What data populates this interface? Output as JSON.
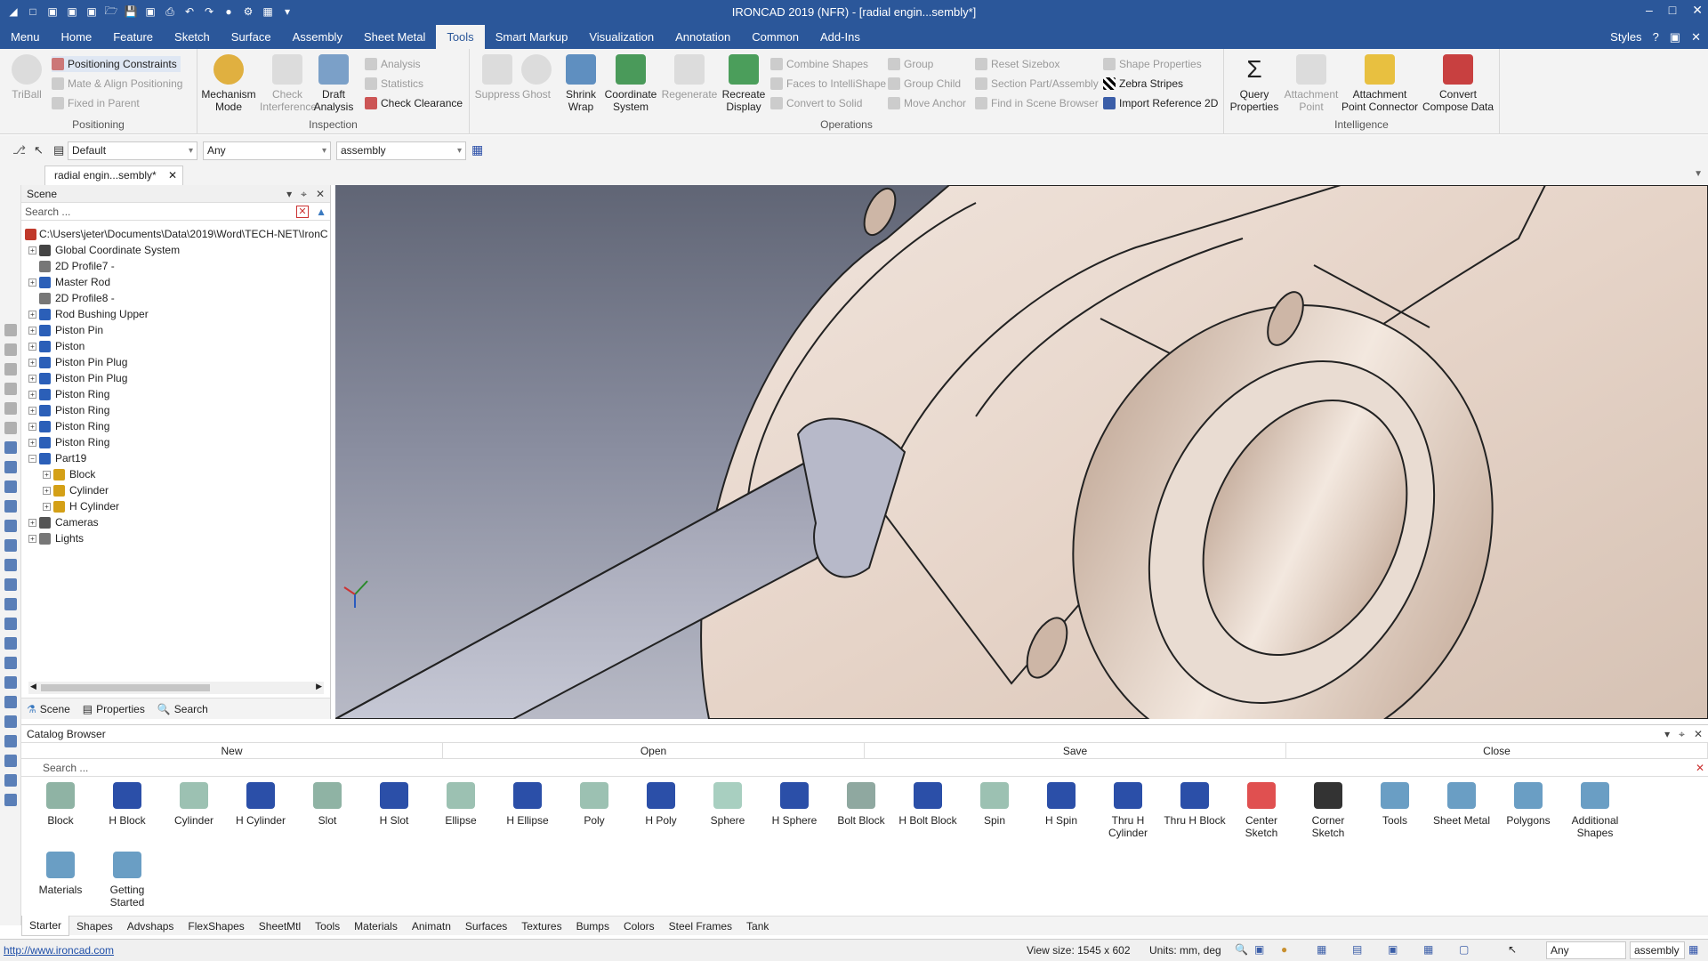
{
  "window": {
    "title": "IRONCAD 2019 (NFR) - [radial engin...sembly*]",
    "min": "–",
    "max": "□",
    "close": "✕"
  },
  "menubar": {
    "tabs": [
      "Menu",
      "Home",
      "Feature",
      "Sketch",
      "Surface",
      "Assembly",
      "Sheet Metal",
      "Tools",
      "Smart Markup",
      "Visualization",
      "Annotation",
      "Common",
      "Add-Ins"
    ],
    "active": "Tools",
    "styles": "Styles",
    "help": "?"
  },
  "ribbon": {
    "positioning": {
      "title": "Positioning",
      "triball": "TriBall",
      "constraints": "Positioning Constraints",
      "mate": "Mate & Align Positioning",
      "fixed": "Fixed in Parent"
    },
    "inspection": {
      "title": "Inspection",
      "mechanism": "Mechanism Mode",
      "check_interference": "Check Interference",
      "draft_analysis": "Draft Analysis",
      "analysis": "Analysis",
      "statistics": "Statistics",
      "check_clearance": "Check Clearance"
    },
    "operations": {
      "title": "Operations",
      "suppress": "Suppress",
      "ghost": "Ghost",
      "shrink_wrap": "Shrink Wrap",
      "coordinate_system": "Coordinate System",
      "regenerate": "Regenerate",
      "recreate_display": "Recreate Display",
      "combine_shapes": "Combine Shapes",
      "faces_intellishape": "Faces to IntelliShape",
      "convert_solid": "Convert to Solid",
      "group": "Group",
      "group_child": "Group Child",
      "move_anchor": "Move Anchor",
      "reset_sizebox": "Reset Sizebox",
      "section_part": "Section Part/Assembly",
      "find_scene": "Find in Scene Browser",
      "shape_properties": "Shape Properties",
      "zebra_stripes": "Zebra Stripes",
      "import_ref": "Import Reference 2D"
    },
    "intelligence": {
      "title": "Intelligence",
      "query_properties": "Query Properties",
      "attachment_point": "Attachment Point",
      "attachment_connector": "Attachment Point Connector",
      "convert_compose": "Convert Compose Data"
    }
  },
  "toolrow": {
    "style_combo": "Default",
    "filter_combo": "Any",
    "level_combo": "assembly"
  },
  "doc_tab": {
    "label": "radial engin...sembly*",
    "close": "✕"
  },
  "scene": {
    "title": "Scene",
    "search_placeholder": "Search ...",
    "tree": [
      {
        "label": "C:\\Users\\jeter\\Documents\\Data\\2019\\Word\\TECH-NET\\IronC",
        "level": 0,
        "icon": "assembly-root-icon",
        "color": "#c0392b",
        "exp": ""
      },
      {
        "label": "Global Coordinate System",
        "level": 1,
        "icon": "coordinate-system-icon",
        "color": "#444",
        "exp": "+"
      },
      {
        "label": "2D Profile7 -",
        "level": 1,
        "icon": "profile-2d-icon",
        "color": "#777",
        "exp": ""
      },
      {
        "label": "Master Rod",
        "level": 1,
        "icon": "part-icon",
        "color": "#2b5fb8",
        "exp": "+"
      },
      {
        "label": "2D Profile8 -",
        "level": 1,
        "icon": "profile-2d-icon",
        "color": "#777",
        "exp": ""
      },
      {
        "label": "Rod Bushing Upper",
        "level": 1,
        "icon": "part-icon",
        "color": "#2b5fb8",
        "exp": "+"
      },
      {
        "label": "Piston Pin",
        "level": 1,
        "icon": "part-icon",
        "color": "#2b5fb8",
        "exp": "+"
      },
      {
        "label": "Piston",
        "level": 1,
        "icon": "part-icon",
        "color": "#2b5fb8",
        "exp": "+"
      },
      {
        "label": "Piston Pin Plug",
        "level": 1,
        "icon": "part-icon",
        "color": "#2b5fb8",
        "exp": "+"
      },
      {
        "label": "Piston Pin Plug",
        "level": 1,
        "icon": "part-icon",
        "color": "#2b5fb8",
        "exp": "+"
      },
      {
        "label": "Piston Ring",
        "level": 1,
        "icon": "part-icon",
        "color": "#2b5fb8",
        "exp": "+"
      },
      {
        "label": "Piston Ring",
        "level": 1,
        "icon": "part-icon",
        "color": "#2b5fb8",
        "exp": "+"
      },
      {
        "label": "Piston Ring",
        "level": 1,
        "icon": "part-icon",
        "color": "#2b5fb8",
        "exp": "+"
      },
      {
        "label": "Piston Ring",
        "level": 1,
        "icon": "part-icon",
        "color": "#2b5fb8",
        "exp": "+"
      },
      {
        "label": "Part19",
        "level": 1,
        "icon": "part-icon",
        "color": "#2b5fb8",
        "exp": "−"
      },
      {
        "label": "Block",
        "level": 2,
        "icon": "feature-icon",
        "color": "#d4a017",
        "exp": "+"
      },
      {
        "label": "Cylinder",
        "level": 2,
        "icon": "feature-icon",
        "color": "#d4a017",
        "exp": "+"
      },
      {
        "label": "H Cylinder",
        "level": 2,
        "icon": "feature-icon",
        "color": "#d4a017",
        "exp": "+"
      },
      {
        "label": "Cameras",
        "level": 1,
        "icon": "camera-icon",
        "color": "#555",
        "exp": "+"
      },
      {
        "label": "Lights",
        "level": 1,
        "icon": "light-icon",
        "color": "#777",
        "exp": "+"
      }
    ],
    "tabs": {
      "scene": "Scene",
      "properties": "Properties",
      "search": "Search"
    }
  },
  "catalog": {
    "title": "Catalog Browser",
    "new": "New",
    "open": "Open",
    "save": "Save",
    "close": "Close",
    "search_placeholder": "Search ...",
    "items": [
      {
        "label": "Block",
        "icon": "block-icon",
        "color": "#8fb3a4"
      },
      {
        "label": "H Block",
        "icon": "h-block-icon",
        "color": "#2b4fa8"
      },
      {
        "label": "Cylinder",
        "icon": "cylinder-icon",
        "color": "#9cc1b2"
      },
      {
        "label": "H Cylinder",
        "icon": "h-cylinder-icon",
        "color": "#2b4fa8"
      },
      {
        "label": "Slot",
        "icon": "slot-icon",
        "color": "#8fb3a4"
      },
      {
        "label": "H Slot",
        "icon": "h-slot-icon",
        "color": "#2b4fa8"
      },
      {
        "label": "Ellipse",
        "icon": "ellipse-icon",
        "color": "#9cc1b2"
      },
      {
        "label": "H Ellipse",
        "icon": "h-ellipse-icon",
        "color": "#2b4fa8"
      },
      {
        "label": "Poly",
        "icon": "poly-icon",
        "color": "#9cc1b2"
      },
      {
        "label": "H Poly",
        "icon": "h-poly-icon",
        "color": "#2b4fa8"
      },
      {
        "label": "Sphere",
        "icon": "sphere-icon",
        "color": "#a8cfc0"
      },
      {
        "label": "H Sphere",
        "icon": "h-sphere-icon",
        "color": "#2b4fa8"
      },
      {
        "label": "Bolt Block",
        "icon": "bolt-block-icon",
        "color": "#8fa8a0"
      },
      {
        "label": "H Bolt Block",
        "icon": "h-bolt-block-icon",
        "color": "#2b4fa8"
      },
      {
        "label": "Spin",
        "icon": "spin-icon",
        "color": "#9cc1b2"
      },
      {
        "label": "H Spin",
        "icon": "h-spin-icon",
        "color": "#2b4fa8"
      },
      {
        "label": "Thru H Cylinder",
        "icon": "thru-h-cylinder-icon",
        "color": "#2b4fa8"
      },
      {
        "label": "Thru H Block",
        "icon": "thru-h-block-icon",
        "color": "#2b4fa8"
      },
      {
        "label": "Center Sketch",
        "icon": "center-sketch-icon",
        "color": "#e05050"
      },
      {
        "label": "Corner Sketch",
        "icon": "corner-sketch-icon",
        "color": "#333"
      },
      {
        "label": "Tools",
        "icon": "tools-folder-icon",
        "color": "#6a9ec4"
      },
      {
        "label": "Sheet Metal",
        "icon": "sheet-metal-folder-icon",
        "color": "#6a9ec4"
      },
      {
        "label": "Polygons",
        "icon": "polygons-folder-icon",
        "color": "#6a9ec4"
      },
      {
        "label": "Additional Shapes",
        "icon": "additional-shapes-folder-icon",
        "color": "#6a9ec4"
      },
      {
        "label": "Materials",
        "icon": "materials-folder-icon",
        "color": "#6a9ec4"
      },
      {
        "label": "Getting Started",
        "icon": "getting-started-folder-icon",
        "color": "#6a9ec4"
      }
    ],
    "tabs": [
      "Starter",
      "Shapes",
      "Advshaps",
      "FlexShapes",
      "SheetMtl",
      "Tools",
      "Materials",
      "Animatn",
      "Surfaces",
      "Textures",
      "Bumps",
      "Colors",
      "Steel Frames",
      "Tank"
    ],
    "active_tab": "Starter"
  },
  "status": {
    "link": "http://www.ironcad.com",
    "view_size": "View size: 1545 x  602",
    "units": "Units: mm, deg",
    "filter": "Any",
    "level": "assembly"
  },
  "colors": {
    "brand": "#2b579a",
    "part_face": "#e8d8cc"
  }
}
